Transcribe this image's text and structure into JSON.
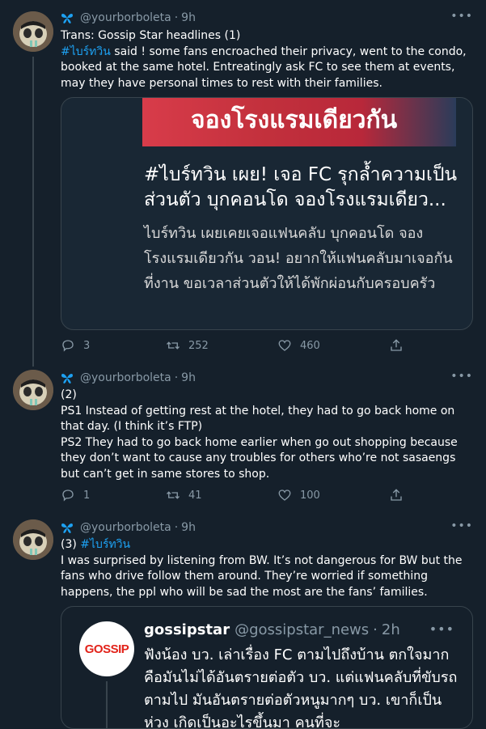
{
  "tweets": [
    {
      "handle": "@yourborboleta",
      "time": "9h",
      "text_prefix": "Trans: Gossip Star headlines (1)\n",
      "hashtag": "#ไบร์ทวิน",
      "text_suffix": " said ! some fans encroached their privacy, went to the condo, booked at the same hotel. Entreatingly ask FC to see them at events, may they have personal times to rest with their families.",
      "card": {
        "image_text": "จองโรงแรมเดียวกัน",
        "title": "#ไบร์ทวิน เผย! เจอ FC รุกล้ำความเป็นส่วนตัว บุกคอนโด จองโรงแรมเดียว...",
        "description": "ไบร์ทวิน เผยเคยเจอแฟนคลับ บุกคอนโด จองโรงแรมเดียวกัน วอน! อยากให้แฟนคลับมาเจอกันที่งาน ขอเวลาส่วนตัวให้ได้พักผ่อนกับครอบครัว"
      },
      "replies": "3",
      "retweets": "252",
      "likes": "460"
    },
    {
      "handle": "@yourborboleta",
      "time": "9h",
      "text": "(2)\nPS1 Instead of getting rest at the hotel, they had to go back home on that day. (I think it’s FTP)\nPS2 They had to go back home earlier when go out shopping because they don’t want to cause any troubles for others who’re not sasaengs but can’t get in same stores to shop.",
      "replies": "1",
      "retweets": "41",
      "likes": "100"
    },
    {
      "handle": "@yourborboleta",
      "time": "9h",
      "text_prefix": "(3) ",
      "hashtag": "#ไบร์ทวิน",
      "text_suffix": "\nI was surprised by listening from BW. It’s not dangerous for BW but the fans who drive follow them around. They’re worried if something happens, the ppl who will be sad the most are the fans’ families.",
      "quote": {
        "logo": "GOSSIP",
        "name": "gossipstar",
        "handle": "@gossipstar_news",
        "time": "2h",
        "text": "ฟังน้อง บว. เล่าเรื่อง FC ตามไปถึงบ้าน ตกใจมาก คือมันไม่ได้อันตรายต่อตัว บว. แต่แฟนคลับที่ขับรถตามไป มันอันตรายต่อตัวหนูมากๆ บว. เขาก็เป็นห่วง เกิดเป็นอะไรขึ้นมา คนที่จะ"
      }
    }
  ],
  "icons": {
    "more": "more-icon",
    "butterfly": "butterfly-icon",
    "reply": "reply-icon",
    "retweet": "retweet-icon",
    "like": "like-icon",
    "share": "share-icon"
  },
  "colors": {
    "background": "#15202b",
    "accent": "#1da1f2",
    "border": "#38444d",
    "muted": "#8899a6"
  }
}
